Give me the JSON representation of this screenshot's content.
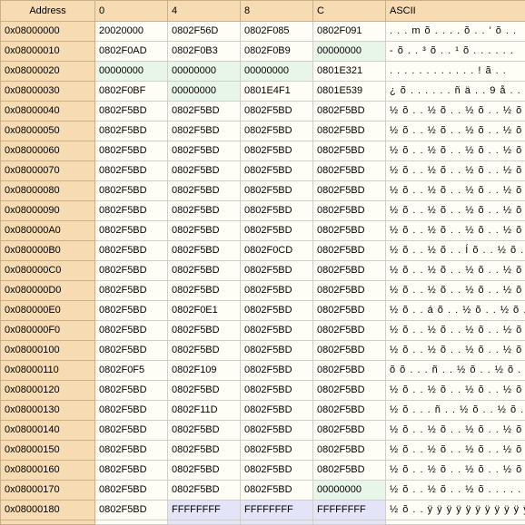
{
  "columns": {
    "address": "Address",
    "c0": "0",
    "c4": "4",
    "c8": "8",
    "cC": "C",
    "ascii": "ASCII"
  },
  "rows": [
    {
      "addr": "0x08000000",
      "c0": "20020000",
      "c4": "0802F56D",
      "c8": "0802F085",
      "cC": "0802F091",
      "ascii": ". . .   m õ . . . . õ . . ' õ . ."
    },
    {
      "addr": "0x08000010",
      "c0": "0802F0AD",
      "c4": "0802F0B3",
      "c8": "0802F0B9",
      "cC": "00000000",
      "ascii": "- õ . . ³ õ . . ¹ õ . . . . . ."
    },
    {
      "addr": "0x08000020",
      "c0": "00000000",
      "c4": "00000000",
      "c8": "00000000",
      "cC": "0801E321",
      "ascii": ". . . . . . . . . . . . ! ã . ."
    },
    {
      "addr": "0x08000030",
      "c0": "0802F0BF",
      "c4": "00000000",
      "c8": "0801E4F1",
      "cC": "0801E539",
      "ascii": "¿ õ . . . . . . ñ ä . . 9 å . ."
    },
    {
      "addr": "0x08000040",
      "c0": "0802F5BD",
      "c4": "0802F5BD",
      "c8": "0802F5BD",
      "cC": "0802F5BD",
      "ascii": "½ õ . . ½ õ . . ½ õ . . ½ õ . ."
    },
    {
      "addr": "0x08000050",
      "c0": "0802F5BD",
      "c4": "0802F5BD",
      "c8": "0802F5BD",
      "cC": "0802F5BD",
      "ascii": "½ õ . . ½ õ . . ½ õ . . ½ õ . ."
    },
    {
      "addr": "0x08000060",
      "c0": "0802F5BD",
      "c4": "0802F5BD",
      "c8": "0802F5BD",
      "cC": "0802F5BD",
      "ascii": "½ õ . . ½ õ . . ½ õ . . ½ õ . ."
    },
    {
      "addr": "0x08000070",
      "c0": "0802F5BD",
      "c4": "0802F5BD",
      "c8": "0802F5BD",
      "cC": "0802F5BD",
      "ascii": "½ õ . . ½ õ . . ½ õ . . ½ õ . ."
    },
    {
      "addr": "0x08000080",
      "c0": "0802F5BD",
      "c4": "0802F5BD",
      "c8": "0802F5BD",
      "cC": "0802F5BD",
      "ascii": "½ õ . . ½ õ . . ½ õ . . ½ õ . ."
    },
    {
      "addr": "0x08000090",
      "c0": "0802F5BD",
      "c4": "0802F5BD",
      "c8": "0802F5BD",
      "cC": "0802F5BD",
      "ascii": "½ õ . . ½ õ . . ½ õ . . ½ õ . ."
    },
    {
      "addr": "0x080000A0",
      "c0": "0802F5BD",
      "c4": "0802F5BD",
      "c8": "0802F5BD",
      "cC": "0802F5BD",
      "ascii": "½ õ . . ½ õ . . ½ õ . . ½ õ . ."
    },
    {
      "addr": "0x080000B0",
      "c0": "0802F5BD",
      "c4": "0802F5BD",
      "c8": "0802F0CD",
      "cC": "0802F5BD",
      "ascii": "½ õ . . ½ õ . . Í õ . . ½ õ . ."
    },
    {
      "addr": "0x080000C0",
      "c0": "0802F5BD",
      "c4": "0802F5BD",
      "c8": "0802F5BD",
      "cC": "0802F5BD",
      "ascii": "½ õ . . ½ õ . . ½ õ . . ½ õ . ."
    },
    {
      "addr": "0x080000D0",
      "c0": "0802F5BD",
      "c4": "0802F5BD",
      "c8": "0802F5BD",
      "cC": "0802F5BD",
      "ascii": "½ õ . . ½ õ . . ½ õ . . ½ õ . ."
    },
    {
      "addr": "0x080000E0",
      "c0": "0802F5BD",
      "c4": "0802F0E1",
      "c8": "0802F5BD",
      "cC": "0802F5BD",
      "ascii": "½ õ . . á õ . . ½ õ . . ½ õ . ."
    },
    {
      "addr": "0x080000F0",
      "c0": "0802F5BD",
      "c4": "0802F5BD",
      "c8": "0802F5BD",
      "cC": "0802F5BD",
      "ascii": "½ õ . . ½ õ . . ½ õ . . ½ õ . ."
    },
    {
      "addr": "0x08000100",
      "c0": "0802F5BD",
      "c4": "0802F5BD",
      "c8": "0802F5BD",
      "cC": "0802F5BD",
      "ascii": "½ õ . . ½ õ . . ½ õ . . ½ õ . ."
    },
    {
      "addr": "0x08000110",
      "c0": "0802F0F5",
      "c4": "0802F109",
      "c8": "0802F5BD",
      "cC": "0802F5BD",
      "ascii": "õ õ . . . ñ . . ½ õ . . ½ õ . ."
    },
    {
      "addr": "0x08000120",
      "c0": "0802F5BD",
      "c4": "0802F5BD",
      "c8": "0802F5BD",
      "cC": "0802F5BD",
      "ascii": "½ õ . . ½ õ . . ½ õ . . ½ õ . ."
    },
    {
      "addr": "0x08000130",
      "c0": "0802F5BD",
      "c4": "0802F11D",
      "c8": "0802F5BD",
      "cC": "0802F5BD",
      "ascii": "½ õ . . . ñ . . ½ õ . . ½ õ . ."
    },
    {
      "addr": "0x08000140",
      "c0": "0802F5BD",
      "c4": "0802F5BD",
      "c8": "0802F5BD",
      "cC": "0802F5BD",
      "ascii": "½ õ . . ½ õ . . ½ õ . . ½ õ . ."
    },
    {
      "addr": "0x08000150",
      "c0": "0802F5BD",
      "c4": "0802F5BD",
      "c8": "0802F5BD",
      "cC": "0802F5BD",
      "ascii": "½ õ . . ½ õ . . ½ õ . . ½ õ . ."
    },
    {
      "addr": "0x08000160",
      "c0": "0802F5BD",
      "c4": "0802F5BD",
      "c8": "0802F5BD",
      "cC": "0802F5BD",
      "ascii": "½ õ . . ½ õ . . ½ õ . . ½ õ . ."
    },
    {
      "addr": "0x08000170",
      "c0": "0802F5BD",
      "c4": "0802F5BD",
      "c8": "0802F5BD",
      "cC": "00000000",
      "ascii": "½ õ . . ½ õ . . ½ õ . . . . . ."
    },
    {
      "addr": "0x08000180",
      "c0": "0802F5BD",
      "c4": "FFFFFFFF",
      "c8": "FFFFFFFF",
      "cC": "FFFFFFFF",
      "ascii": "½ õ . . ÿ ÿ ÿ ÿ ÿ ÿ ÿ ÿ ÿ ÿ ÿ ÿ"
    }
  ],
  "colors": {
    "header_bg": "#f6dbb3",
    "address_bg": "#f6dbb3",
    "cell_bg": "#fffef6",
    "zero_cell_bg": "#e8f6e8",
    "ff_cell_bg": "#e4e4f8",
    "grid_line": "#d0cfc8"
  }
}
